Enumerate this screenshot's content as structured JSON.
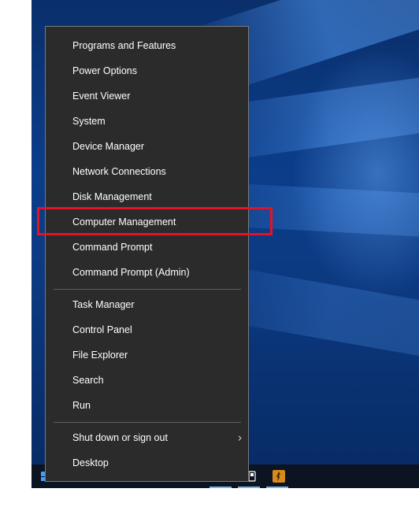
{
  "menu": {
    "group1": [
      {
        "label": "Programs and Features"
      },
      {
        "label": "Power Options"
      },
      {
        "label": "Event Viewer"
      },
      {
        "label": "System"
      },
      {
        "label": "Device Manager"
      },
      {
        "label": "Network Connections"
      },
      {
        "label": "Disk Management"
      },
      {
        "label": "Computer Management"
      },
      {
        "label": "Command Prompt"
      },
      {
        "label": "Command Prompt (Admin)"
      }
    ],
    "group2": [
      {
        "label": "Task Manager"
      },
      {
        "label": "Control Panel"
      },
      {
        "label": "File Explorer"
      },
      {
        "label": "Search"
      },
      {
        "label": "Run"
      }
    ],
    "group3": [
      {
        "label": "Shut down or sign out",
        "submenu_icon": "chevron-right-icon"
      },
      {
        "label": "Desktop"
      }
    ]
  },
  "highlight": {
    "target": "Computer Management",
    "color": "#e81123"
  },
  "taskbar": {
    "start_icon": "windows-logo-icon",
    "apps": [
      {
        "icon": "tablet-app-icon"
      },
      {
        "icon": "game-app-icon"
      }
    ]
  },
  "colors": {
    "menu_background": "#2b2b2b",
    "menu_text": "#ffffff",
    "desktop_accent": "#0b3d8a"
  }
}
